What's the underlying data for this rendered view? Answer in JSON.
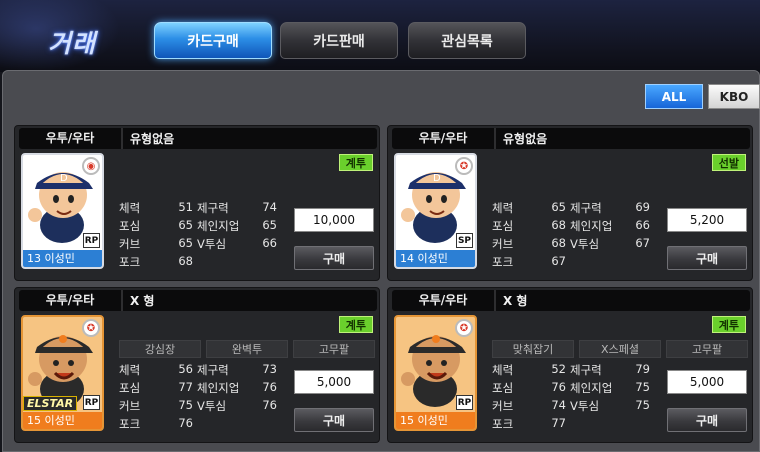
{
  "header": {
    "title": "거래",
    "tabs": [
      {
        "label": "카드구매",
        "active": true
      },
      {
        "label": "카드판매",
        "active": false
      },
      {
        "label": "관심목록",
        "active": false
      }
    ]
  },
  "filters": [
    {
      "label": "ALL",
      "active": true
    },
    {
      "label": "KBO",
      "active": false
    }
  ],
  "colors": {
    "active_tab": "#2c8ee6",
    "status_badge": "#6ad02c",
    "card_bg": "#252629",
    "normal_card_frame": "#2c7fd4",
    "special_card_frame": "#f07d1e"
  },
  "cards": [
    {
      "hand": "우투/우타",
      "type": "유형없음",
      "status": "계투",
      "player": {
        "number": "13",
        "name": "이성민",
        "position": "RP",
        "frame": "white",
        "emblem": "team-emblem-blue"
      },
      "skills": [],
      "stats": [
        {
          "label": "체력",
          "value": "51"
        },
        {
          "label": "제구력",
          "value": "74"
        },
        {
          "label": "포심",
          "value": "65"
        },
        {
          "label": "체인지업",
          "value": "65"
        },
        {
          "label": "커브",
          "value": "65"
        },
        {
          "label": "V투심",
          "value": "66"
        },
        {
          "label": "포크",
          "value": "68"
        }
      ],
      "price": "10,000",
      "buy_label": "구매"
    },
    {
      "hand": "우투/우타",
      "type": "유형없음",
      "status": "선발",
      "player": {
        "number": "14",
        "name": "이성민",
        "position": "SP",
        "frame": "white",
        "emblem": "team-emblem-red"
      },
      "skills": [],
      "stats": [
        {
          "label": "체력",
          "value": "65"
        },
        {
          "label": "제구력",
          "value": "69"
        },
        {
          "label": "포심",
          "value": "68"
        },
        {
          "label": "체인지업",
          "value": "66"
        },
        {
          "label": "커브",
          "value": "68"
        },
        {
          "label": "V투심",
          "value": "67"
        },
        {
          "label": "포크",
          "value": "67"
        }
      ],
      "price": "5,200",
      "buy_label": "구매"
    },
    {
      "hand": "우투/우타",
      "type": "X 형",
      "status": "계투",
      "player": {
        "number": "15",
        "name": "이성민",
        "position": "RP",
        "frame": "orange",
        "emblem": "team-emblem-red",
        "special": "ELSTAR"
      },
      "skills": [
        "강심장",
        "완벽투",
        "고무팔"
      ],
      "stats": [
        {
          "label": "체력",
          "value": "56"
        },
        {
          "label": "제구력",
          "value": "73"
        },
        {
          "label": "포심",
          "value": "77"
        },
        {
          "label": "체인지업",
          "value": "76"
        },
        {
          "label": "커브",
          "value": "75"
        },
        {
          "label": "V투심",
          "value": "76"
        },
        {
          "label": "포크",
          "value": "76"
        }
      ],
      "price": "5,000",
      "buy_label": "구매"
    },
    {
      "hand": "우투/우타",
      "type": "X 형",
      "status": "계투",
      "player": {
        "number": "15",
        "name": "이성민",
        "position": "RP",
        "frame": "orange",
        "emblem": "team-emblem-red"
      },
      "skills": [
        "맞춰잡기",
        "X스페셜",
        "고무팔"
      ],
      "stats": [
        {
          "label": "체력",
          "value": "52"
        },
        {
          "label": "제구력",
          "value": "79"
        },
        {
          "label": "포심",
          "value": "76"
        },
        {
          "label": "체인지업",
          "value": "75"
        },
        {
          "label": "커브",
          "value": "74"
        },
        {
          "label": "V투심",
          "value": "75"
        },
        {
          "label": "포크",
          "value": "77"
        }
      ],
      "price": "5,000",
      "buy_label": "구매"
    }
  ]
}
